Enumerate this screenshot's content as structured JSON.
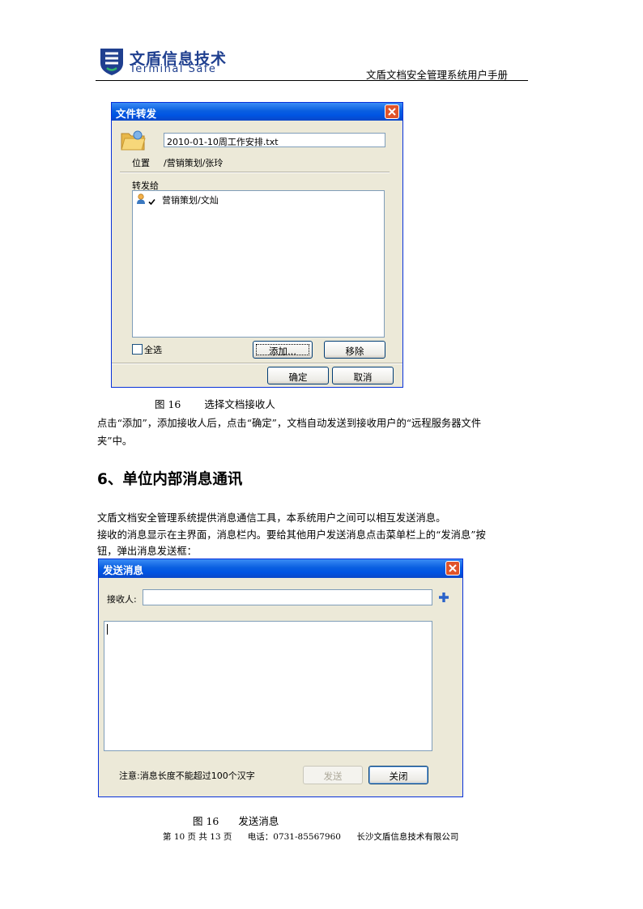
{
  "header": {
    "logo_cn": "文盾信息技术",
    "logo_en": "Terminal Safe",
    "doc_title": "文盾文档安全管理系统用户手册"
  },
  "forward_dialog": {
    "title": "文件转发",
    "file_name": "2010-01-10周工作安排.txt",
    "location_label": "位置",
    "location_value": "/营销策划/张玲",
    "forward_to_label": "转发给",
    "recipients": [
      "营销策划/文灿"
    ],
    "select_all_label": "全选",
    "add_button": "添加...",
    "remove_button": "移除",
    "ok_button": "确定",
    "cancel_button": "取消"
  },
  "figure1_caption": {
    "number": "图 16",
    "text": "选择文档接收人"
  },
  "paragraph1": {
    "line1": "点击“添加”，添加接收人后，点击“确定”，文档自动发送到接收用户的“远程服务器文件",
    "line2": "夹”中。"
  },
  "section_heading": "6、单位内部消息通讯",
  "paragraph2": {
    "line1": "文盾文档安全管理系统提供消息通信工具，本系统用户之间可以相互发送消息。",
    "line2": "接收的消息显示在主界面，消息栏内。要给其他用户发送消息点击菜单栏上的“发消息”按",
    "line3": "钮，弹出消息发送框："
  },
  "message_dialog": {
    "title": "发送消息",
    "recipient_label": "接收人:",
    "recipient_value": "",
    "message_body": "",
    "note": "注意:消息长度不能超过100个汉字",
    "send_button": "发送",
    "close_button": "关闭"
  },
  "figure2_caption": {
    "number": "图 16",
    "text": "发送消息"
  },
  "footer": {
    "page_info": "第 10 页 共 13 页",
    "phone": "电话：0731-85567960",
    "company": "长沙文盾信息技术有限公司"
  },
  "colors": {
    "title_bar": "#0054e3",
    "dialog_bg": "#ece9d8",
    "close_button": "#e0542a",
    "logo": "#1f3f8f",
    "add_icon": "#2a62c9"
  }
}
